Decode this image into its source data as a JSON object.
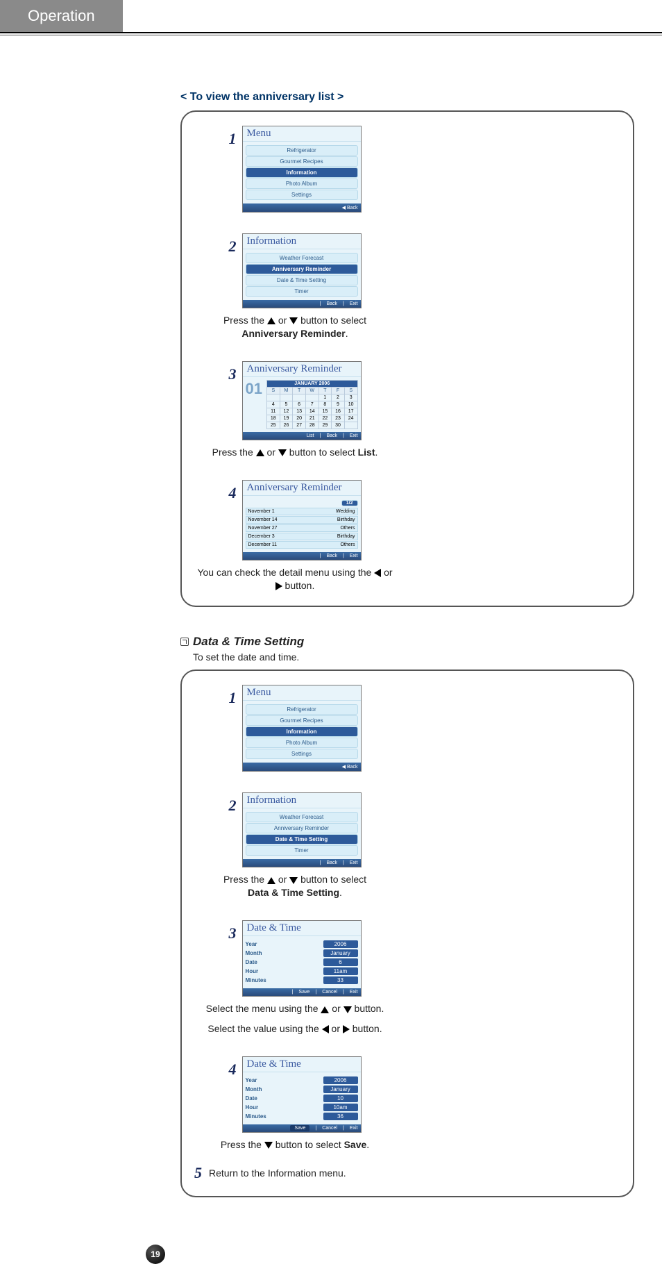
{
  "header": {
    "title": "Operation"
  },
  "pageNumber": "19",
  "section1": {
    "heading": "< To view the anniversary list >",
    "steps": {
      "s1": {
        "num": "1",
        "screen": {
          "title": "Menu",
          "items": [
            "Refrigerator",
            "Gourmet Recipes",
            "Information",
            "Photo Album",
            "Settings"
          ],
          "highlight": "Information",
          "footerBack": "◀ Back"
        }
      },
      "s2": {
        "num": "2",
        "screen": {
          "title": "Information",
          "items": [
            "Weather Forecast",
            "Anniversary Reminder",
            "Date & Time Setting",
            "Timer"
          ],
          "highlight": "Anniversary Reminder",
          "footer": [
            "Back",
            "Exit"
          ]
        },
        "caption_pre": "Press the ",
        "caption_mid": " or ",
        "caption_post": " button to select ",
        "caption_bold": "Anniversary Reminder",
        "caption_end": "."
      },
      "s3": {
        "num": "3",
        "screen": {
          "title": "Anniversary Reminder",
          "month": "JANUARY 2006",
          "bignum": "01",
          "weekHdr": [
            "S",
            "M",
            "T",
            "W",
            "T",
            "F",
            "S"
          ],
          "rows": [
            [
              "",
              "",
              "",
              "",
              "1",
              "2",
              "3"
            ],
            [
              "4",
              "5",
              "6",
              "7",
              "8",
              "9",
              "10"
            ],
            [
              "11",
              "12",
              "13",
              "14",
              "15",
              "16",
              "17"
            ],
            [
              "18",
              "19",
              "20",
              "21",
              "22",
              "23",
              "24"
            ],
            [
              "25",
              "26",
              "27",
              "28",
              "29",
              "30",
              ""
            ]
          ],
          "footer": [
            "List",
            "Back",
            "Exit"
          ]
        },
        "caption_pre": "Press the ",
        "caption_mid": " or ",
        "caption_post": " button to select ",
        "caption_bold": "List",
        "caption_end": "."
      },
      "s4": {
        "num": "4",
        "screen": {
          "title": "Anniversary Reminder",
          "pager": "1/2",
          "events": [
            {
              "d": "November 1",
              "t": "Wedding"
            },
            {
              "d": "November 14",
              "t": "Birthday"
            },
            {
              "d": "November 27",
              "t": "Others"
            },
            {
              "d": "December 3",
              "t": "Birthday"
            },
            {
              "d": "December 11",
              "t": "Others"
            }
          ],
          "footer": [
            "Back",
            "Exit"
          ]
        },
        "caption_pre": "You can check the detail menu using the ",
        "caption_mid": " or ",
        "caption_post": " button."
      }
    }
  },
  "section2": {
    "heading": "Data & Time Setting",
    "desc": "To set the date and time.",
    "steps": {
      "s1": {
        "num": "1",
        "screen": {
          "title": "Menu",
          "items": [
            "Refrigerator",
            "Gourmet Recipes",
            "Information",
            "Photo Album",
            "Settings"
          ],
          "highlight": "Information",
          "footerBack": "◀ Back"
        }
      },
      "s2": {
        "num": "2",
        "screen": {
          "title": "Information",
          "items": [
            "Weather Forecast",
            "Anniversary Reminder",
            "Date & Time Setting",
            "Timer"
          ],
          "highlight": "Date & Time Setting",
          "footer": [
            "Back",
            "Exit"
          ]
        },
        "caption_pre": "Press the ",
        "caption_mid": " or ",
        "caption_post": " button to select ",
        "caption_bold": "Data & Time Setting",
        "caption_end": "."
      },
      "s3": {
        "num": "3",
        "screen": {
          "title": "Date & Time",
          "rows": [
            {
              "label": "Year",
              "val": "2006"
            },
            {
              "label": "Month",
              "val": "January"
            },
            {
              "label": "Date",
              "val": "6"
            },
            {
              "label": "Hour",
              "val": "11am"
            },
            {
              "label": "Minutes",
              "val": "33"
            }
          ],
          "footer": [
            "Save",
            "Cancel",
            "Exit"
          ]
        },
        "caption1_pre": "Select the menu using the ",
        "caption1_mid": " or ",
        "caption1_post": " button.",
        "caption2_pre": "Select the value using the ",
        "caption2_mid": " or ",
        "caption2_post": " button."
      },
      "s4": {
        "num": "4",
        "screen": {
          "title": "Date & Time",
          "rows": [
            {
              "label": "Year",
              "val": "2006"
            },
            {
              "label": "Month",
              "val": "January"
            },
            {
              "label": "Date",
              "val": "10"
            },
            {
              "label": "Hour",
              "val": "10am"
            },
            {
              "label": "Minutes",
              "val": "36"
            }
          ],
          "footer": [
            "Save",
            "Cancel",
            "Exit"
          ],
          "highlightFooter": "Save"
        },
        "caption_pre": "Press the ",
        "caption_post": " button to select ",
        "caption_bold": "Save",
        "caption_end": "."
      },
      "s5": {
        "num": "5",
        "text_pre": "Return to the ",
        "text_bold": "Information",
        "text_post": " menu."
      }
    }
  }
}
